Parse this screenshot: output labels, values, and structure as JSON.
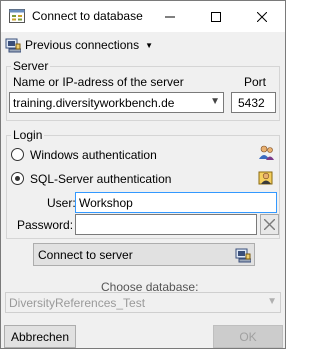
{
  "window": {
    "title": "Connect to database"
  },
  "menu": {
    "previous_connections": "Previous connections"
  },
  "server": {
    "group_label": "Server",
    "name_label": "Name or IP-adress of the server",
    "port_label": "Port",
    "name_value": "training.diversityworkbench.de",
    "port_value": "5432"
  },
  "login": {
    "group_label": "Login",
    "windows_auth": "Windows authentication",
    "sql_auth": "SQL-Server authentication",
    "user_label": "User:",
    "user_value": "Workshop",
    "password_label": "Password:",
    "password_value": "",
    "selected": "sql"
  },
  "connect": {
    "label": "Connect to server"
  },
  "database": {
    "label": "Choose database:",
    "value": "DiversityReferences_Test"
  },
  "footer": {
    "cancel": "Abbrechen",
    "ok": "OK"
  }
}
